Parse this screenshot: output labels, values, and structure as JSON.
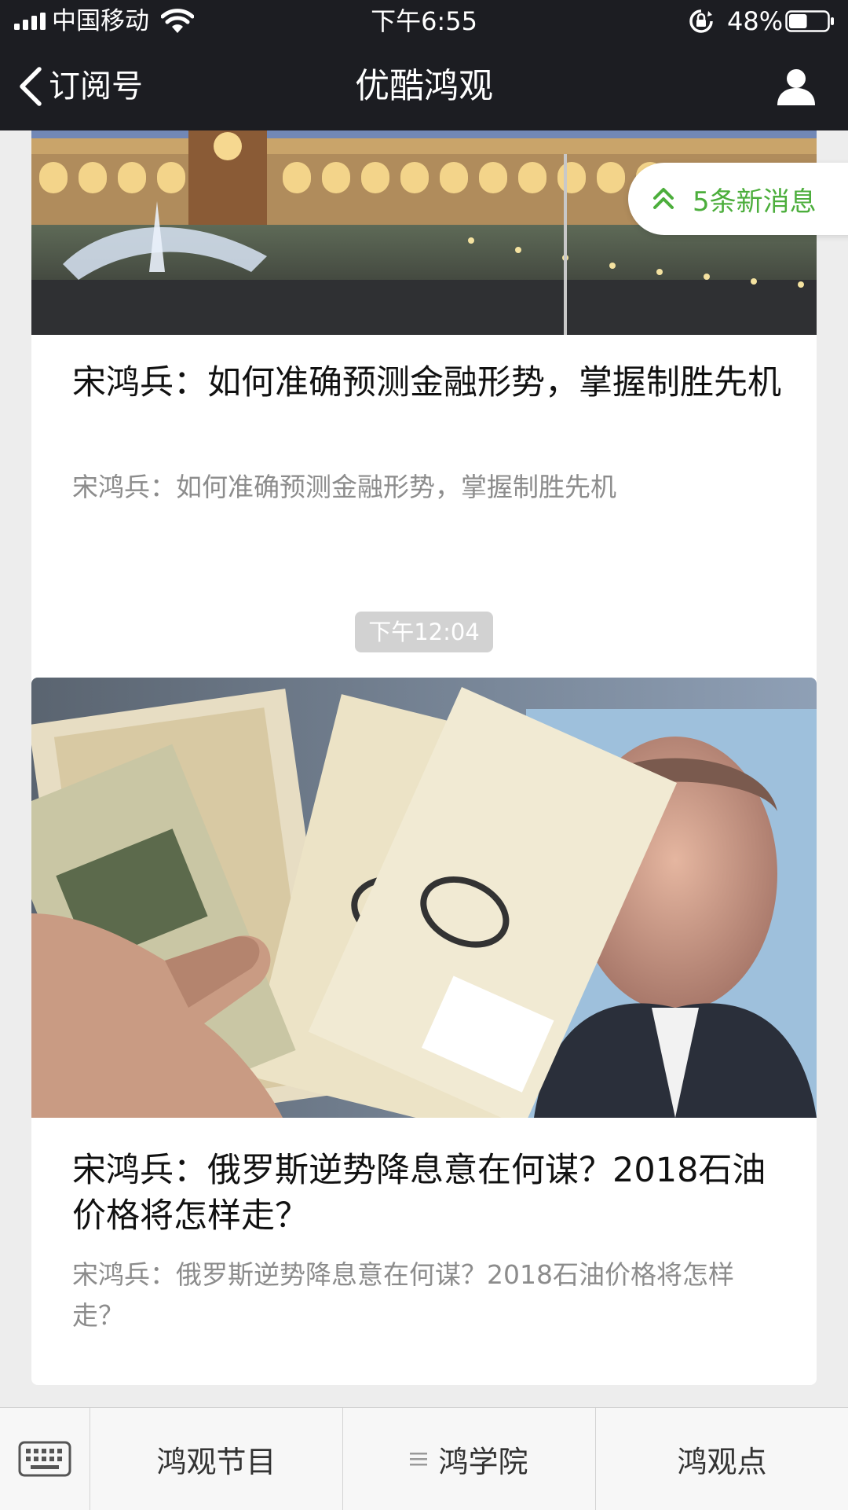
{
  "status_bar": {
    "carrier": "中国移动",
    "time": "下午6:55",
    "battery_percent": "48%",
    "battery_level": 0.48
  },
  "nav": {
    "back_label": "订阅号",
    "title": "优酷鸿观"
  },
  "new_messages": {
    "label": "5条新消息"
  },
  "articles": [
    {
      "title": "宋鸿兵：如何准确预测金融形势，掌握制胜先机",
      "description": "宋鸿兵：如何准确预测金融形势，掌握制胜先机"
    },
    {
      "title": "宋鸿兵：俄罗斯逆势降息意在何谋？2018石油价格将怎样走？",
      "description": "宋鸿兵：俄罗斯逆势降息意在何谋？2018石油价格将怎样走？"
    }
  ],
  "time_divider": "下午12:04",
  "bottom_menu": {
    "tabs": [
      {
        "label": "鸿观节目"
      },
      {
        "label": "鸿学院",
        "has_submenu_icon": true
      },
      {
        "label": "鸿观点"
      }
    ]
  }
}
